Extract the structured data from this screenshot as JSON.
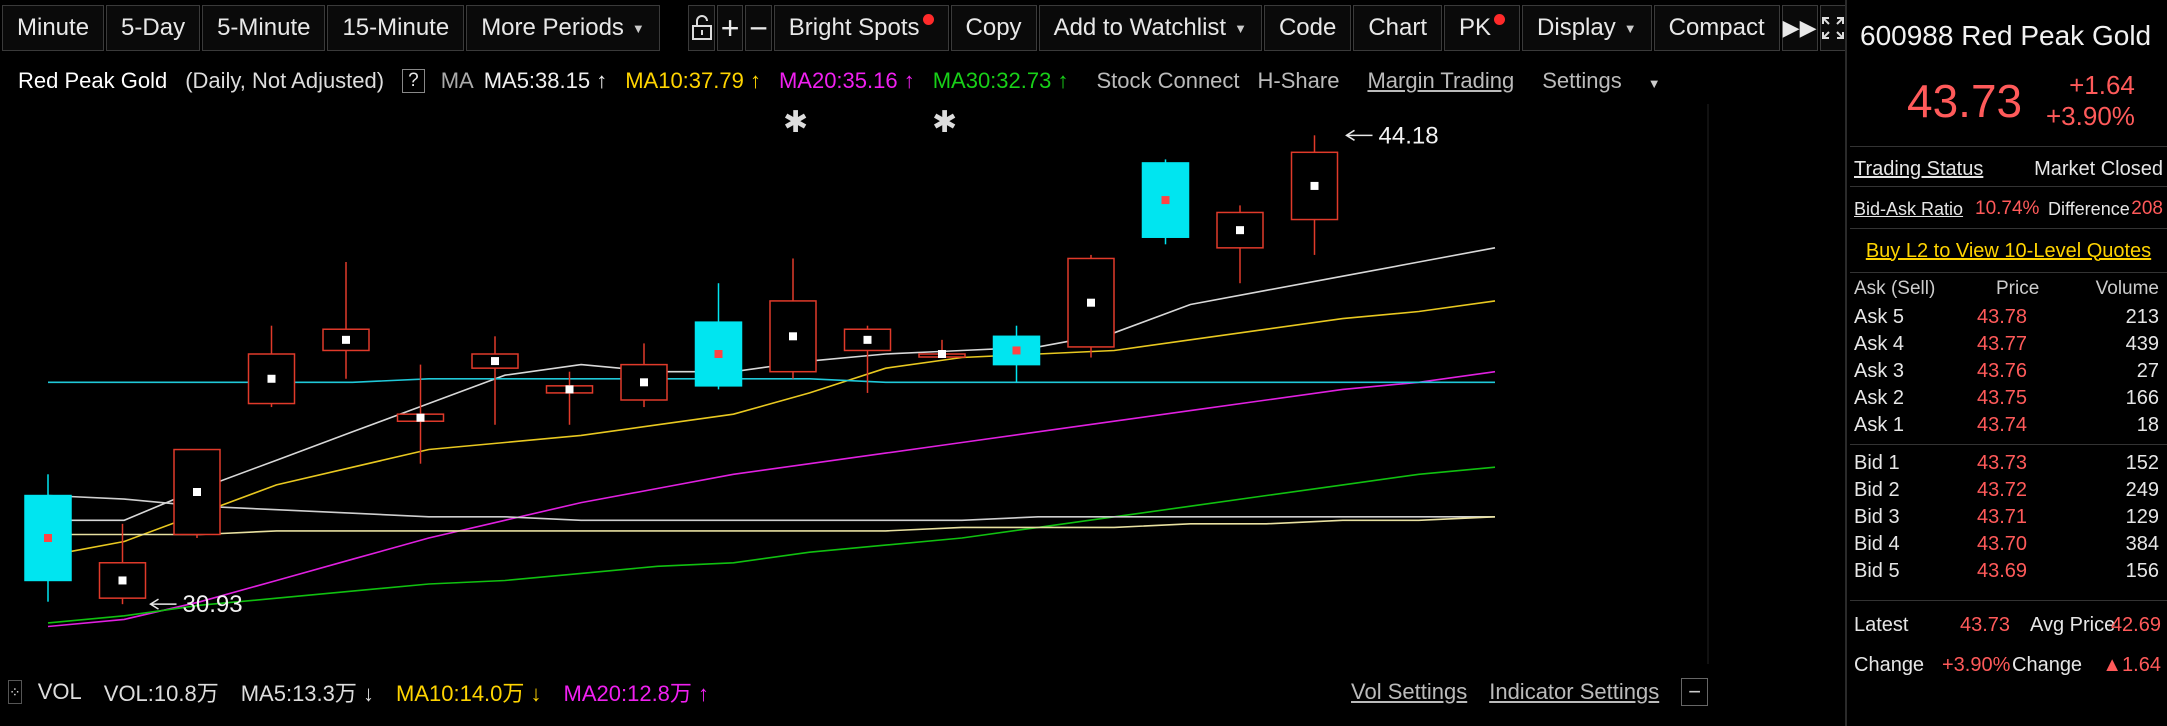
{
  "toolbar": {
    "minute": "Minute",
    "five_day": "5-Day",
    "five_minute": "5-Minute",
    "fifteen_minute": "15-Minute",
    "more_periods": "More Periods",
    "bright_spots": "Bright Spots",
    "copy": "Copy",
    "add_to_watchlist": "Add to Watchlist",
    "code": "Code",
    "chart": "Chart",
    "pk": "PK",
    "display": "Display",
    "compact": "Compact"
  },
  "indicators": {
    "stock_name": "Red Peak Gold",
    "period": "(Daily, Not Adjusted)",
    "help": "?",
    "ma": "MA",
    "ma5": "MA5:38.15 ↑",
    "ma10": "MA10:37.79 ↑",
    "ma20": "MA20:35.16 ↑",
    "ma30": "MA30:32.73 ↑",
    "stock_connect": "Stock Connect",
    "h_share": "H-Share",
    "margin_trading": "Margin Trading",
    "settings": "Settings"
  },
  "volume_bar": {
    "vol": "VOL",
    "vol_value": "VOL:10.8万",
    "ma5": "MA5:13.3万 ↓",
    "ma10": "MA10:14.0万 ↓",
    "ma20": "MA20:12.8万 ↑",
    "vol_settings": "Vol Settings",
    "indicator_settings": "Indicator Settings",
    "collapse": "−"
  },
  "chart_data": {
    "type": "candlestick",
    "y_ticks": [
      "44.00",
      "42.00",
      "40.00",
      "38.00",
      "36.00",
      "34.00",
      "32.00"
    ],
    "ylim": [
      30.2,
      44.5
    ],
    "high_label": "44.18",
    "low_label": "30.93",
    "candles": [
      {
        "o": 31.6,
        "c": 34.0,
        "h": 34.6,
        "l": 31.0,
        "up": false
      },
      {
        "o": 32.1,
        "c": 31.1,
        "h": 33.2,
        "l": 30.93,
        "up": true
      },
      {
        "o": 32.9,
        "c": 35.3,
        "h": 35.3,
        "l": 32.8,
        "up": true
      },
      {
        "o": 36.6,
        "c": 38.0,
        "h": 38.8,
        "l": 36.5,
        "up": true
      },
      {
        "o": 38.1,
        "c": 38.7,
        "h": 40.6,
        "l": 37.3,
        "up": true
      },
      {
        "o": 36.1,
        "c": 36.3,
        "h": 37.7,
        "l": 34.9,
        "up": true
      },
      {
        "o": 37.6,
        "c": 38.0,
        "h": 38.5,
        "l": 36.0,
        "up": true
      },
      {
        "o": 36.9,
        "c": 37.1,
        "h": 37.5,
        "l": 36.0,
        "up": true
      },
      {
        "o": 36.7,
        "c": 37.7,
        "h": 38.3,
        "l": 36.5,
        "up": true
      },
      {
        "o": 38.9,
        "c": 37.1,
        "h": 40.0,
        "l": 37.0,
        "up": false
      },
      {
        "o": 37.5,
        "c": 39.5,
        "h": 40.7,
        "l": 37.3,
        "up": true
      },
      {
        "o": 38.1,
        "c": 38.7,
        "h": 38.8,
        "l": 36.9,
        "up": true
      },
      {
        "o": 38.0,
        "c": 38.0,
        "h": 38.4,
        "l": 37.9,
        "up": true
      },
      {
        "o": 38.5,
        "c": 37.7,
        "h": 38.8,
        "l": 37.2,
        "up": false
      },
      {
        "o": 38.2,
        "c": 40.7,
        "h": 40.8,
        "l": 37.9,
        "up": true
      },
      {
        "o": 43.4,
        "c": 41.3,
        "h": 43.5,
        "l": 41.1,
        "up": false
      },
      {
        "o": 41.0,
        "c": 42.0,
        "h": 42.2,
        "l": 40.0,
        "up": true
      },
      {
        "o": 41.8,
        "c": 43.7,
        "h": 44.18,
        "l": 40.8,
        "up": true
      }
    ],
    "series": [
      {
        "color": "#d8d8d8",
        "values": [
          33.3,
          33.3,
          34.2,
          35.0,
          35.8,
          36.6,
          37.4,
          37.7,
          37.5,
          37.5,
          37.8,
          38.0,
          38.1,
          38.2,
          38.6,
          39.4,
          39.8,
          40.2,
          40.6,
          41.0
        ]
      },
      {
        "color": "#e8c820",
        "values": [
          32.3,
          32.7,
          33.5,
          34.3,
          34.8,
          35.3,
          35.5,
          35.7,
          36.0,
          36.3,
          36.9,
          37.6,
          37.9,
          38.0,
          38.1,
          38.4,
          38.7,
          39.0,
          39.2,
          39.5
        ]
      },
      {
        "color": "#e020e0",
        "values": [
          30.3,
          30.5,
          31.0,
          31.6,
          32.2,
          32.8,
          33.3,
          33.8,
          34.2,
          34.6,
          34.9,
          35.2,
          35.5,
          35.8,
          36.1,
          36.4,
          36.7,
          37.0,
          37.2,
          37.5
        ]
      },
      {
        "color": "#10c010",
        "values": [
          30.4,
          30.6,
          30.9,
          31.1,
          31.3,
          31.5,
          31.6,
          31.8,
          32.0,
          32.1,
          32.4,
          32.6,
          32.8,
          33.1,
          33.4,
          33.7,
          34.0,
          34.3,
          34.6,
          34.8
        ]
      },
      {
        "color": "#20c8d8",
        "values": [
          37.2,
          37.2,
          37.2,
          37.2,
          37.2,
          37.3,
          37.3,
          37.3,
          37.3,
          37.3,
          37.3,
          37.2,
          37.2,
          37.2,
          37.2,
          37.2,
          37.2,
          37.2,
          37.2,
          37.2
        ]
      },
      {
        "color": "#cfcfcf",
        "values": [
          34.0,
          33.9,
          33.7,
          33.6,
          33.5,
          33.4,
          33.4,
          33.3,
          33.3,
          33.3,
          33.3,
          33.3,
          33.3,
          33.4,
          33.4,
          33.4,
          33.4,
          33.4,
          33.4,
          33.4
        ]
      },
      {
        "color": "#e8e0a0",
        "values": [
          32.9,
          32.9,
          32.9,
          33.0,
          33.0,
          33.0,
          33.0,
          33.0,
          33.0,
          33.0,
          33.0,
          33.0,
          33.1,
          33.1,
          33.1,
          33.2,
          33.2,
          33.3,
          33.3,
          33.4
        ]
      }
    ]
  },
  "panel": {
    "code": "600988",
    "name": "Red Peak Gold",
    "price": "43.73",
    "change_abs": "+1.64",
    "change_pct": "+3.90%",
    "trading_status_label": "Trading Status",
    "trading_status_value": "Market Closed",
    "bid_ask_ratio_label": "Bid-Ask Ratio",
    "bid_ask_ratio_value": "10.74%",
    "difference_label": "Difference",
    "difference_value": "208",
    "buy_l2": "Buy L2 to View 10-Level Quotes",
    "ob_headers": [
      "Ask (Sell)",
      "Price",
      "Volume"
    ],
    "asks": [
      {
        "label": "Ask 5",
        "price": "43.78",
        "volume": "213"
      },
      {
        "label": "Ask 4",
        "price": "43.77",
        "volume": "439"
      },
      {
        "label": "Ask 3",
        "price": "43.76",
        "volume": "27"
      },
      {
        "label": "Ask 2",
        "price": "43.75",
        "volume": "166"
      },
      {
        "label": "Ask 1",
        "price": "43.74",
        "volume": "18"
      }
    ],
    "bids": [
      {
        "label": "Bid 1",
        "price": "43.73",
        "volume": "152"
      },
      {
        "label": "Bid 2",
        "price": "43.72",
        "volume": "249"
      },
      {
        "label": "Bid 3",
        "price": "43.71",
        "volume": "129"
      },
      {
        "label": "Bid 4",
        "price": "43.70",
        "volume": "384"
      },
      {
        "label": "Bid 5",
        "price": "43.69",
        "volume": "156"
      }
    ],
    "latest_label": "Latest",
    "latest_value": "43.73",
    "avg_price_label": "Avg Price",
    "avg_price_value": "42.69",
    "change_label": "Change",
    "change_pct_value": "+3.90%",
    "change_label2": "Change",
    "change_abs_value": "▲1.64"
  }
}
